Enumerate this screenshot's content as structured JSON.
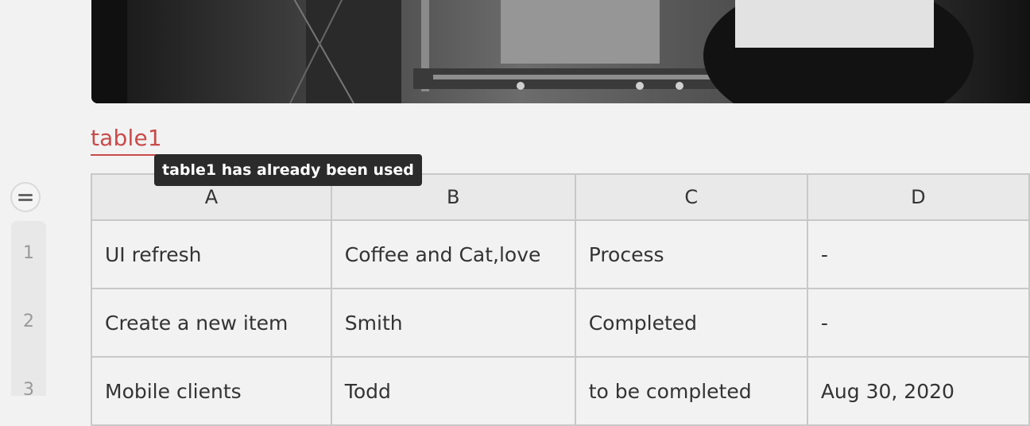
{
  "image": {
    "description": "grayscale photo banner"
  },
  "table": {
    "name": "table1",
    "tooltip": "table1 has already been used",
    "columns": [
      "A",
      "B",
      "C",
      "D"
    ],
    "row_numbers": [
      "1",
      "2",
      "3"
    ],
    "rows": [
      [
        "UI refresh",
        "Coffee and Cat,love",
        "Process",
        "-"
      ],
      [
        "Create a new item",
        "Smith",
        "Completed",
        "-"
      ],
      [
        "Mobile clients",
        "Todd",
        "to be completed",
        "Aug 30, 2020"
      ]
    ]
  },
  "colors": {
    "accent": "#c94a4a",
    "tooltip_bg": "#2b2b2b",
    "grid_border": "#c8c8c8",
    "header_bg": "#e9e9e9",
    "page_bg": "#f2f2f2"
  },
  "icons": {
    "gutter_toggle": "row-gutter-toggle-icon"
  }
}
